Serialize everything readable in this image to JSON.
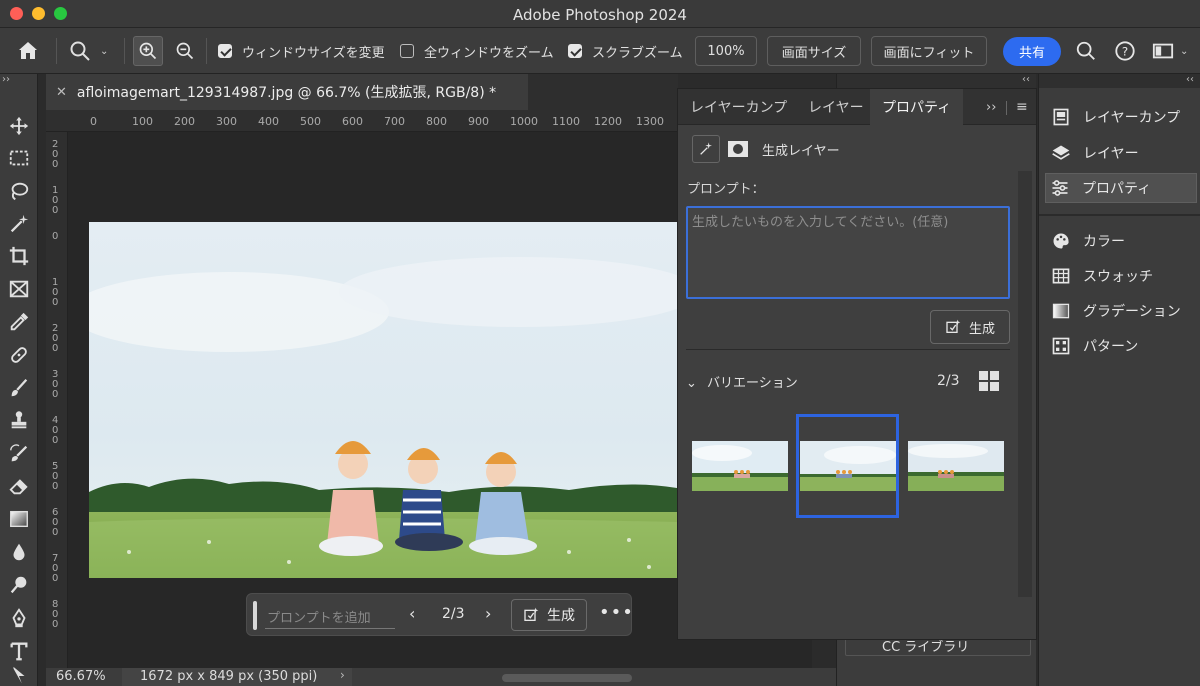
{
  "window": {
    "title": "Adobe Photoshop 2024"
  },
  "options_bar": {
    "resize_windows_label": "ウィンドウサイズを変更",
    "resize_windows_checked": true,
    "zoom_all_label": "全ウィンドウをズーム",
    "zoom_all_checked": false,
    "scrubby_zoom_label": "スクラブズーム",
    "scrubby_zoom_checked": true,
    "zoom_100_label": "100%",
    "fit_screen_label": "画面サイズ",
    "fill_screen_label": "画面にフィット",
    "share_label": "共有"
  },
  "document": {
    "tab_title": "afloimagemart_129314987.jpg @ 66.7% (生成拡張, RGB/8) *",
    "ruler_top": [
      "0",
      "100",
      "200",
      "300",
      "400",
      "500",
      "600",
      "700",
      "800",
      "900",
      "1000",
      "1100",
      "1200",
      "1300"
    ],
    "ruler_left": [
      "200",
      "100",
      "0",
      "100",
      "200",
      "300",
      "400",
      "500",
      "600",
      "700",
      "800"
    ]
  },
  "status_bar": {
    "zoom": "66.67%",
    "dimensions": "1672 px x 849 px (350 ppi)"
  },
  "taskbar": {
    "prompt_placeholder": "プロンプトを追加",
    "counter": "2/3",
    "generate_label": "生成"
  },
  "properties_panel": {
    "tabs": [
      "レイヤーカンプ",
      "レイヤー",
      "プロパティ"
    ],
    "active_tab": "プロパティ",
    "layer_type": "生成レイヤー",
    "prompt_label": "プロンプト：",
    "prompt_placeholder": "生成したいものを入力してください。(任意)",
    "generate_label": "生成",
    "variations_label": "バリエーション",
    "variations_count": "2/3",
    "selected_variation": 2
  },
  "dock_left": {
    "partial_label": "CC ライブラリ"
  },
  "dock_right": {
    "items": [
      {
        "label": "レイヤーカンプ",
        "icon": "layer-comps-icon"
      },
      {
        "label": "レイヤー",
        "icon": "layers-icon"
      },
      {
        "label": "プロパティ",
        "icon": "properties-icon"
      },
      {
        "label": "カラー",
        "icon": "color-palette-icon"
      },
      {
        "label": "スウォッチ",
        "icon": "swatches-icon"
      },
      {
        "label": "グラデーション",
        "icon": "gradient-icon"
      },
      {
        "label": "パターン",
        "icon": "patterns-icon"
      }
    ],
    "active": "プロパティ"
  },
  "colors": {
    "accent": "#2d6bf0",
    "selection_border": "#2d64e0",
    "panel_bg": "#3c3c3c"
  }
}
